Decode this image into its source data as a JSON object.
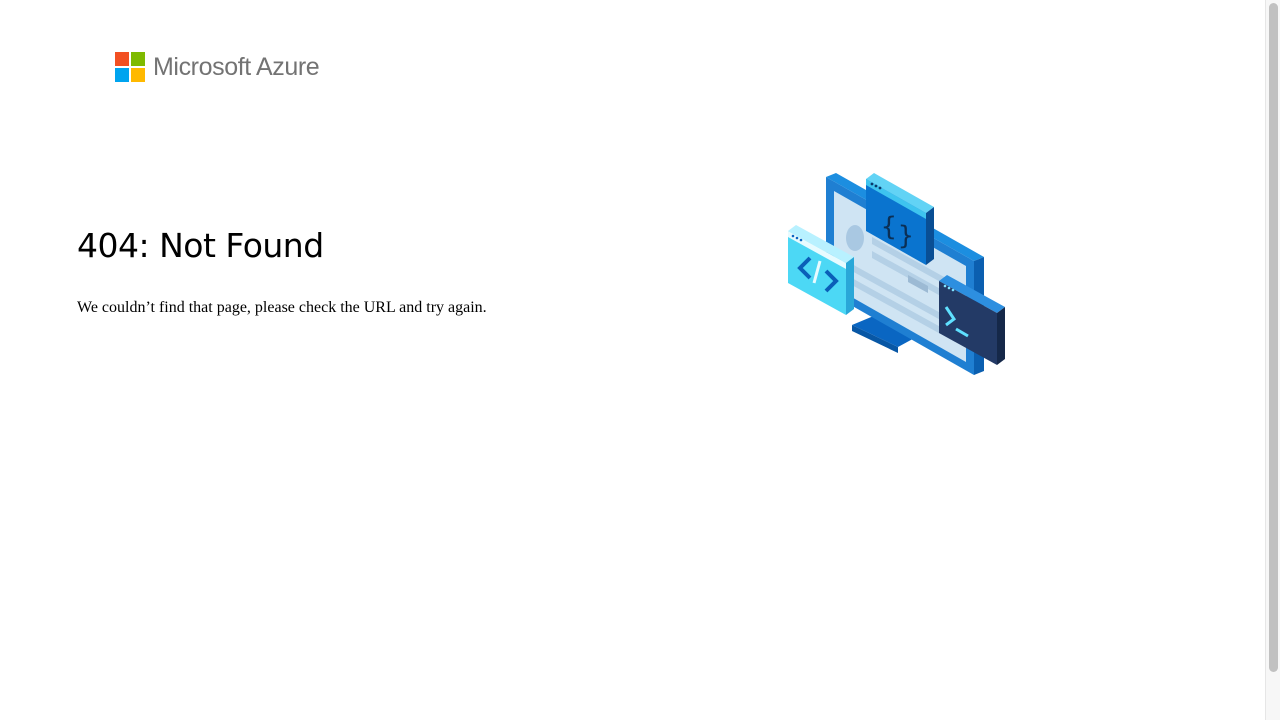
{
  "brand": {
    "name": "Microsoft Azure",
    "colors": {
      "red": "#f25022",
      "green": "#7fba00",
      "blue": "#00a4ef",
      "yellow": "#ffb900"
    }
  },
  "error": {
    "title": "404: Not Found",
    "message": "We couldn’t find that page, please check the URL and try again."
  },
  "illustration": {
    "icon": "developer-code-windows-illustration",
    "code_glyphs": [
      "{ }",
      "</>",
      ">_"
    ]
  },
  "scrollbar": {
    "position": 0
  }
}
